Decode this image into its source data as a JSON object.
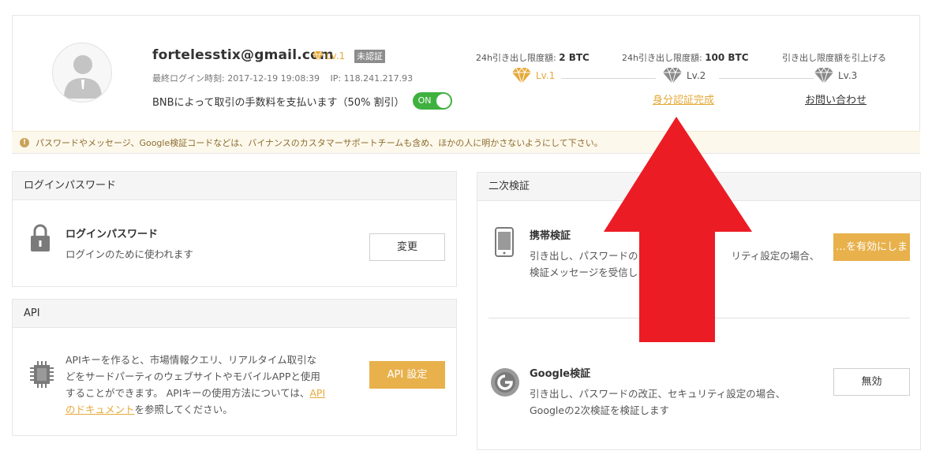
{
  "account": {
    "email": "fortelesstix@gmail.com",
    "level_badge": "Lv.1",
    "unverified_badge": "未認証",
    "last_login_label": "最終ログイン時刻: 2017-12-19 19:08:39",
    "ip_label": "IP: 118.241.217.93",
    "bnb_fee_text": "BNBによって取引の手数料を支払います（50% 割引）",
    "bnb_toggle_label": "ON"
  },
  "levels": {
    "limit1_prefix": "24h引き出し限度額:",
    "limit1_value": "2 BTC",
    "limit2_prefix": "24h引き出し限度額:",
    "limit2_value": "100 BTC",
    "raise_limit": "引き出し限度額を引上げる",
    "lv1": "Lv.1",
    "lv2": "Lv.2",
    "lv3": "Lv.3",
    "lv2_link": "身分認証完成",
    "lv3_link": "お問い合わせ",
    "active_color": "#e6a93a",
    "inactive_color": "#8a8a8a"
  },
  "notice": {
    "text": "パスワードやメッセージ、Google検証コードなどは、バイナンスのカスタマーサポートチームも含め、ほかの人に明かさないようにして下さい。"
  },
  "login_password": {
    "header": "ログインパスワード",
    "title": "ログインパスワード",
    "desc": "ログインのために使われます",
    "button": "変更"
  },
  "api": {
    "header": "API",
    "desc_line1": "APIキーを作ると、市場情報クエリ、リアルタイム取引な",
    "desc_line2": "どをサードパーティのウェブサイトやモバイルAPPと使用",
    "desc_line3_prefix": "することができます。 APIキーの使用方法については、",
    "desc_link_line1": "API",
    "desc_link_line2": "のドキュメント",
    "desc_line4_suffix": "を参照してください。",
    "button": "API 設定"
  },
  "two_factor": {
    "header": "二次検証",
    "sms_title": "携帯検証",
    "sms_desc_line1": "引き出し、パスワードの",
    "sms_desc_line1_end": "リティ設定の場合、",
    "sms_desc_line2": "検証メッセージを受信し",
    "sms_button": "…を有効にしま",
    "google_title": "Google検証",
    "google_desc_line1": "引き出し、パスワードの改正、セキュリティ設定の場合、",
    "google_desc_line2": "Googleの2次検証を検証します",
    "google_button": "無効"
  },
  "colors": {
    "gold": "#e8b14c",
    "toggle_green": "#3fb13f",
    "arrow_red": "#ec1c24"
  }
}
